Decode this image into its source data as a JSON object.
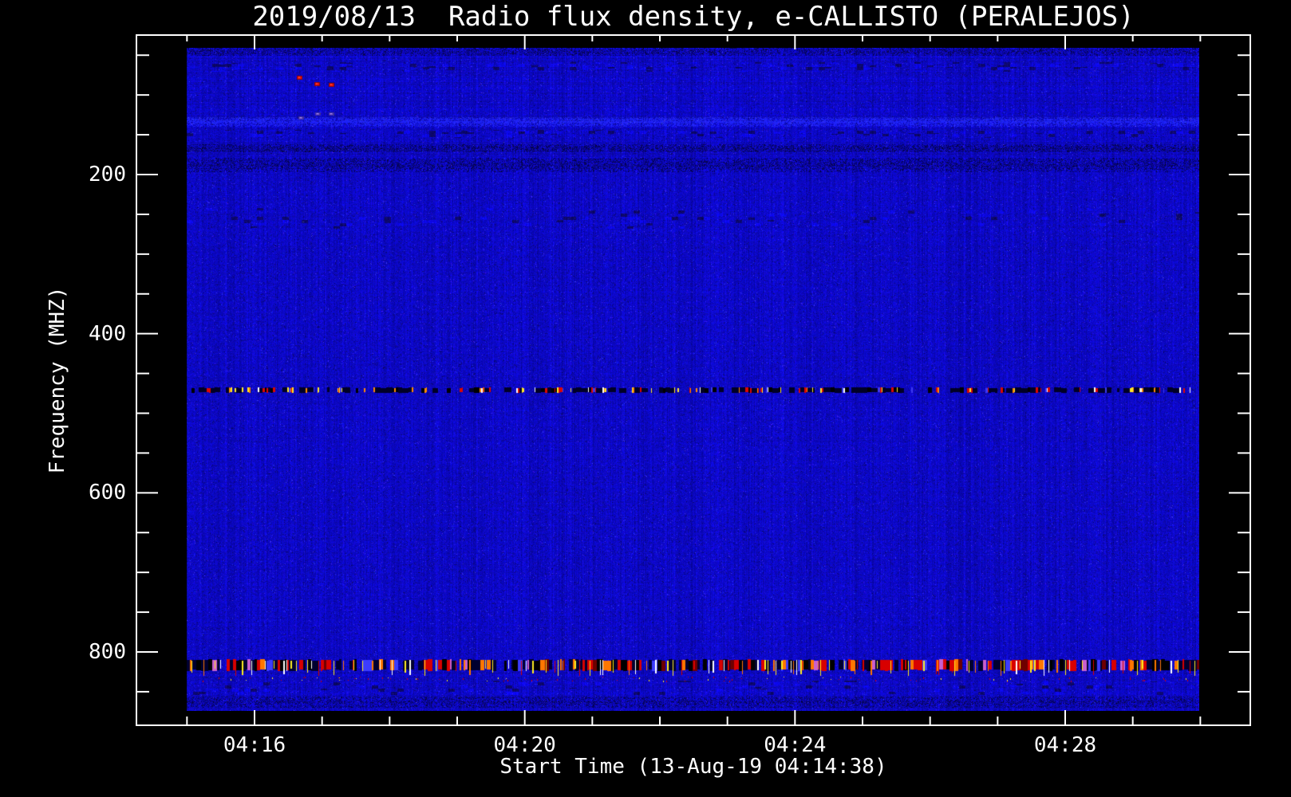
{
  "window": {
    "background": "#000000",
    "text_color": "#ffffff"
  },
  "chart_data": {
    "type": "heatmap",
    "title": "2019/08/13  Radio flux density, e-CALLISTO (PERALEJOS)",
    "xlabel": "Start Time (13-Aug-19 04:14:38)",
    "ylabel": "Frequency (MHZ)",
    "legend": "none",
    "grid": "off",
    "x_axis": {
      "start_time": "04:14:38",
      "data_span": [
        "04:15:00",
        "04:30:00"
      ],
      "major_ticks": [
        {
          "minute": 16,
          "label": "04:16"
        },
        {
          "minute": 20,
          "label": "04:20"
        },
        {
          "minute": 24,
          "label": "04:24"
        },
        {
          "minute": 28,
          "label": "04:28"
        }
      ],
      "minor_tick_minutes": [
        15,
        17,
        18,
        19,
        21,
        22,
        23,
        25,
        26,
        27,
        29,
        30
      ]
    },
    "y_axis": {
      "direction": "increasing-downward",
      "image_range_mhz": [
        41,
        873
      ],
      "major_ticks": [
        {
          "mhz": 200,
          "label": "200"
        },
        {
          "mhz": 400,
          "label": "400"
        },
        {
          "mhz": 600,
          "label": "600"
        },
        {
          "mhz": 800,
          "label": "800"
        }
      ],
      "minor_step_mhz": 50,
      "minor_range_mhz": [
        50,
        850
      ]
    },
    "colormap": {
      "background_blue": "#0c08c4",
      "noise_dark": "#000060",
      "noise_bright": "#3434f0",
      "axis_color": "#ffffff"
    },
    "rfi_bands": [
      {
        "freq_mhz": 470,
        "width_mhz": 8,
        "label": "narrow speckled interference band",
        "palette": {
          "dark": "#000026",
          "black": "#000000",
          "red": "#dd0600",
          "orange": "#ff8a00",
          "yellow": "#ffe92a",
          "white": "#ffffff",
          "blue": "#3d39f2"
        }
      },
      {
        "freq_mhz": 820,
        "width_mhz": 20,
        "label": "strong broadband interference band",
        "palette": {
          "dark": "#000030",
          "black": "#000000",
          "red": "#d80000",
          "darkred": "#6e0000",
          "orange": "#ff7700",
          "yellow": "#ffee22",
          "white": "#ffffff",
          "blue": "#3c3cff",
          "pink": "#c95fd0"
        }
      }
    ],
    "texture_stripes": [
      {
        "freq_mhz": 45,
        "half_width_mhz": 4,
        "mode": "dark",
        "strength": 0.25
      },
      {
        "freq_mhz": 64,
        "half_width_mhz": 5,
        "mode": "mottle",
        "strength": 0.5
      },
      {
        "freq_mhz": 133,
        "half_width_mhz": 5,
        "mode": "light",
        "strength": 0.7
      },
      {
        "freq_mhz": 148,
        "half_width_mhz": 4,
        "mode": "mottle",
        "strength": 0.4
      },
      {
        "freq_mhz": 166,
        "half_width_mhz": 4,
        "mode": "dark",
        "strength": 0.45
      },
      {
        "freq_mhz": 187,
        "half_width_mhz": 8,
        "mode": "dark",
        "strength": 0.3
      },
      {
        "freq_mhz": 255,
        "half_width_mhz": 12,
        "mode": "mottle",
        "strength": 0.2
      },
      {
        "freq_mhz": 845,
        "half_width_mhz": 8,
        "mode": "mottle",
        "strength": 0.3
      },
      {
        "freq_mhz": 863,
        "half_width_mhz": 6,
        "mode": "dark",
        "strength": 0.2
      }
    ],
    "point_features": [
      {
        "time": "04:16:40",
        "freq_mhz": 78,
        "type": "red-speck",
        "color": "#e81212"
      },
      {
        "time": "04:16:55",
        "freq_mhz": 86,
        "type": "red-speck",
        "color": "#e81212"
      },
      {
        "time": "04:17:08",
        "freq_mhz": 87,
        "type": "red-speck",
        "color": "#e81212"
      },
      {
        "time": "04:16:41",
        "freq_mhz": 129,
        "type": "purple-speck",
        "color": "#7a55d2"
      },
      {
        "time": "04:16:56",
        "freq_mhz": 124,
        "type": "purple-speck",
        "color": "#7a55d2"
      },
      {
        "time": "04:17:08",
        "freq_mhz": 124,
        "type": "purple-speck",
        "color": "#7a55d2"
      }
    ]
  }
}
